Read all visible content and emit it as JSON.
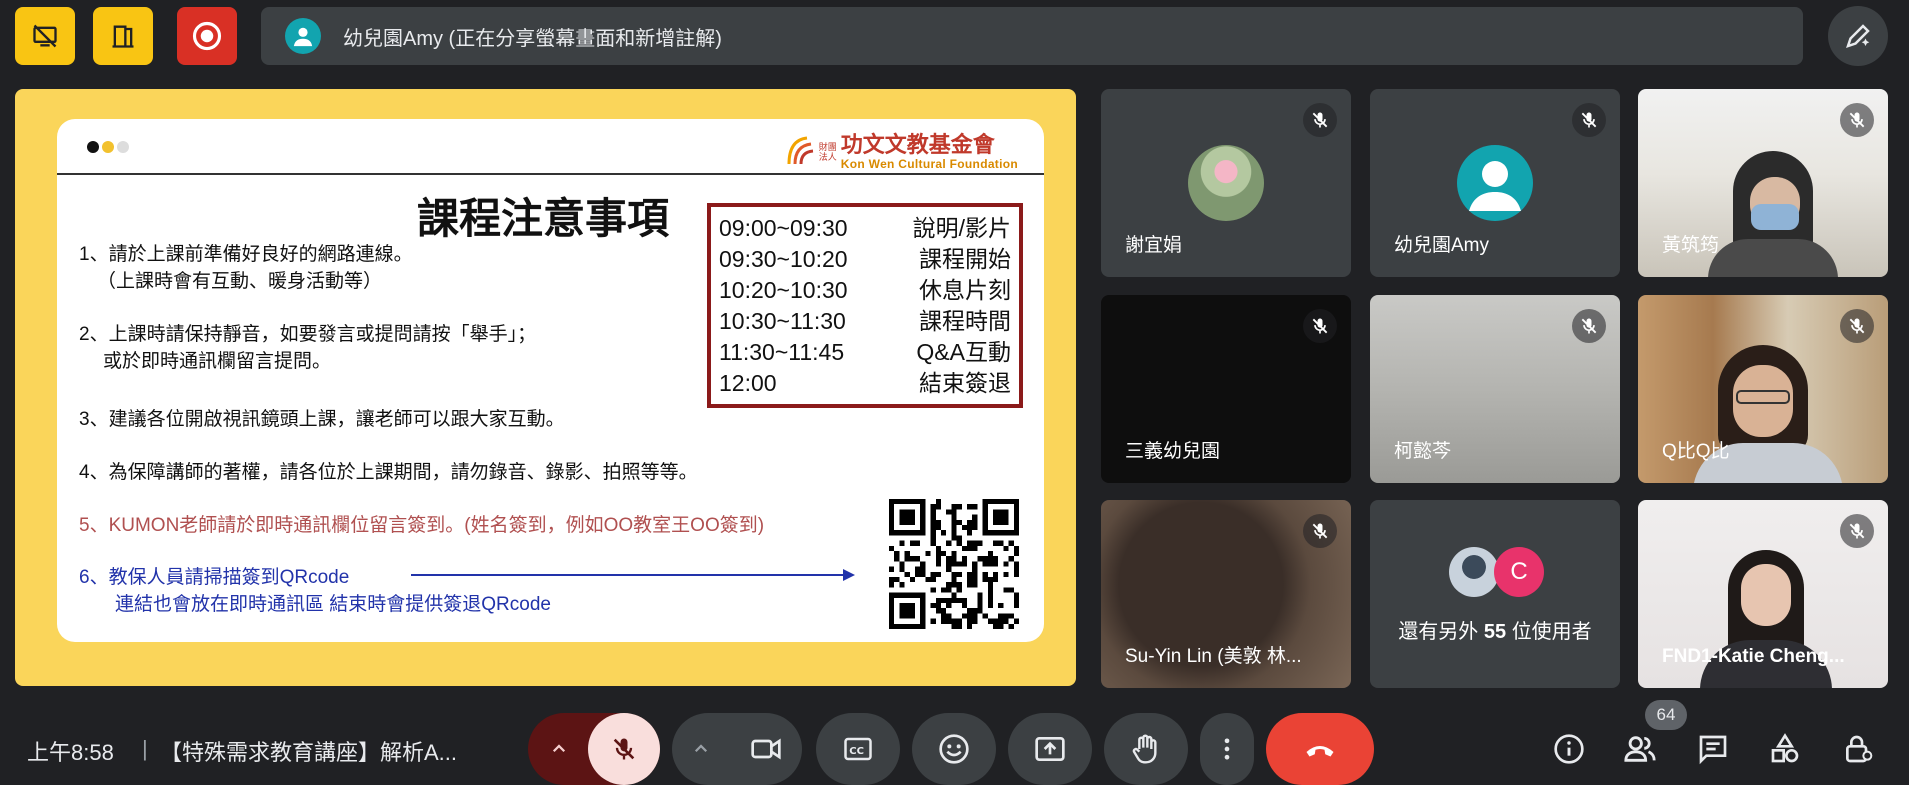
{
  "banner": {
    "text": "幼兒園Amy (正在分享螢幕畫面和新增註解)"
  },
  "slide": {
    "org_small": "財團\n法人",
    "org_name": "功文文教基金會",
    "org_en": "Kon Wen Cultural Foundation",
    "title": "課程注意事項",
    "items": [
      {
        "line1": "1、請於上課前準備好良好的網路連線。",
        "line2": "（上課時會有互動、暖身活動等）"
      },
      {
        "line1": "2、上課時請保持靜音，如要發言或提問請按「舉手」；",
        "line2": "或於即時通訊欄留言提問。"
      },
      {
        "line1": "3、建議各位開啟視訊鏡頭上課，讓老師可以跟大家互動。"
      },
      {
        "line1": "4、為保障講師的著權，請各位於上課期間，請勿錄音、錄影、拍照等等。"
      },
      {
        "line1": "5、KUMON老師請於即時通訊欄位留言簽到。(姓名簽到，例如OO教室王OO簽到)"
      },
      {
        "line1": "6、教保人員請掃描簽到QRcode",
        "line2": "連結也會放在即時通訊區 結束時會提供簽退QRcode"
      }
    ],
    "schedule": [
      {
        "time": "09:00~09:30",
        "label": "說明/影片"
      },
      {
        "time": "09:30~10:20",
        "label": "課程開始"
      },
      {
        "time": "10:20~10:30",
        "label": "休息片刻"
      },
      {
        "time": "10:30~11:30",
        "label": "課程時間"
      },
      {
        "time": "11:30~11:45",
        "label": "Q&A互動"
      },
      {
        "time": "12:00",
        "label": "結束簽退"
      }
    ]
  },
  "participants": [
    {
      "name": "謝宜娟",
      "muted": true
    },
    {
      "name": "幼兒園Amy",
      "muted": true
    },
    {
      "name": "黃筑筠",
      "muted": true
    },
    {
      "name": "三義幼兒園",
      "muted": true
    },
    {
      "name": "柯懿芩",
      "muted": true
    },
    {
      "name": "Q比Q比",
      "muted": true
    },
    {
      "name": "Su-Yin Lin (美敦 林...",
      "muted": true
    },
    {
      "name": "FND1-Katie Cheng...",
      "muted": true
    }
  ],
  "others_tile": {
    "text_pre": "還有另外",
    "count": "55",
    "text_post": "位使用者",
    "avatar_letter": "C"
  },
  "bottom": {
    "time": "上午8:58",
    "separator": "|",
    "meeting_title": "【特殊需求教育講座】解析A...",
    "participant_count": "64"
  },
  "colors": {
    "accent_red": "#ea4335",
    "yellow": "#f9c513",
    "tile_bg": "#3c4043",
    "app_bg": "#202124"
  },
  "icons": [
    "present-off-icon",
    "exit-icon",
    "record-icon",
    "pen-icon",
    "mic-off-icon",
    "camera-icon",
    "captions-icon",
    "emoji-icon",
    "present-icon",
    "raise-hand-icon",
    "more-vert-icon",
    "hang-up-icon",
    "info-icon",
    "people-icon",
    "chat-icon",
    "activities-icon",
    "host-controls-icon"
  ]
}
